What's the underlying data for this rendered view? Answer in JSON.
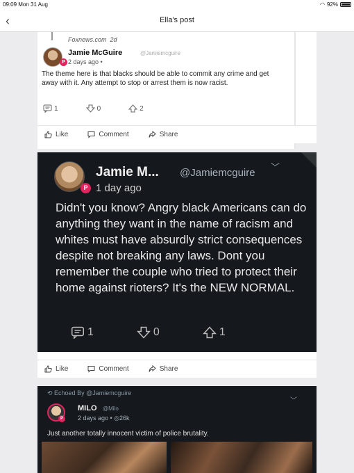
{
  "status_bar": {
    "time": "09:09",
    "date": "Mon 31 Aug",
    "battery": "92%"
  },
  "nav": {
    "back_icon": "chevron-left-icon",
    "title": "Ella's post"
  },
  "post1": {
    "source": "Foxnews.com",
    "source_age": "2d",
    "name": "Jamie McGuire",
    "handle": "@Jamiemcguire",
    "time": "2 days ago •",
    "body": "The theme here is that blacks should be able to commit any crime and get away with it. Any attempt to stop or arrest them is now racist.",
    "comments": "1",
    "votes": "0",
    "shares": "2",
    "actions": {
      "like": "Like",
      "comment": "Comment",
      "share": "Share"
    }
  },
  "post2": {
    "name": "Jamie M...",
    "handle": "@Jamiemcguire",
    "time": "1 day ago",
    "body": "Didn't you know? Angry black Americans can do anything they want in the name of racism and whites must have absurdly strict consequences despite not breaking any laws. Dont you remember the couple who tried to protect their home against rioters? It's the NEW NORMAL.",
    "comments": "1",
    "votes": "0",
    "shares": "1",
    "actions": {
      "like": "Like",
      "comment": "Comment",
      "share": "Share"
    }
  },
  "post3": {
    "echoed_by": "Echoed By @Jamiemcguire",
    "name": "MILO",
    "handle": "@Milo",
    "time": "2 days ago • ◎26k",
    "body": "Just another totally innocent victim of police brutality."
  },
  "badge_letter": "P"
}
